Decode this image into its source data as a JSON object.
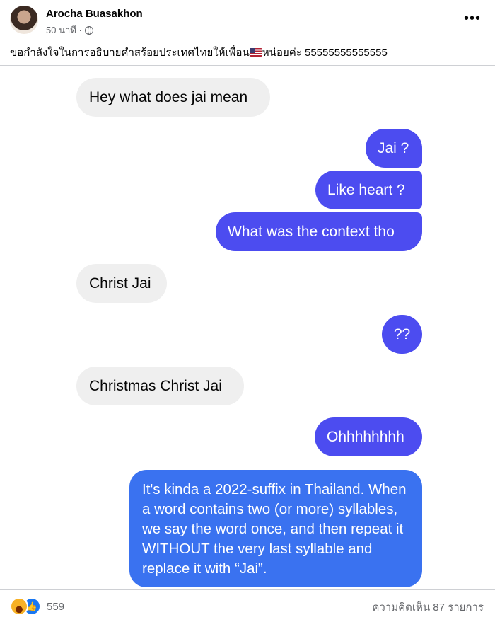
{
  "post": {
    "author": "Arocha Buasakhon",
    "time": "50 นาที ·",
    "privacy_icon": "globe-icon",
    "more_label": "•••",
    "caption_before_flag": "ขอกำลังใจในการอธิบายคำสร้อยประเทศไทยให้เพื่อน",
    "caption_flag_icon": "us-flag-icon",
    "caption_after_flag": "หน่อยค่ะ 55555555555555"
  },
  "messages": [
    {
      "side": "received",
      "text": "Hey what does jai mean"
    },
    {
      "side": "sent",
      "text": "Jai ?"
    },
    {
      "side": "sent",
      "text": "Like heart ?"
    },
    {
      "side": "sent",
      "text": "What was the context tho"
    },
    {
      "side": "received",
      "text": "Christ Jai"
    },
    {
      "side": "sent",
      "text": "??"
    },
    {
      "side": "received",
      "text": "Christmas Christ Jai"
    },
    {
      "side": "sent",
      "text": "Ohhhhhhhh"
    },
    {
      "side": "sent",
      "text": "It's kinda a 2022-suffix in Thailand. When a word contains two (or more) syllables, we say the word once, and then repeat it WITHOUT the very last syllable and replace it with “Jai”."
    }
  ],
  "footer": {
    "reaction_icons": [
      "haha-emoji-icon",
      "like-thumb-icon"
    ],
    "reaction_count": "559",
    "comments_label": "ความคิดเห็น 87 รายการ"
  },
  "colors": {
    "sent_bubble": "#4c4cf0",
    "sent_bubble_last": "#3a72f0",
    "received_bubble": "#efefef",
    "secondary_text": "#65676b"
  }
}
